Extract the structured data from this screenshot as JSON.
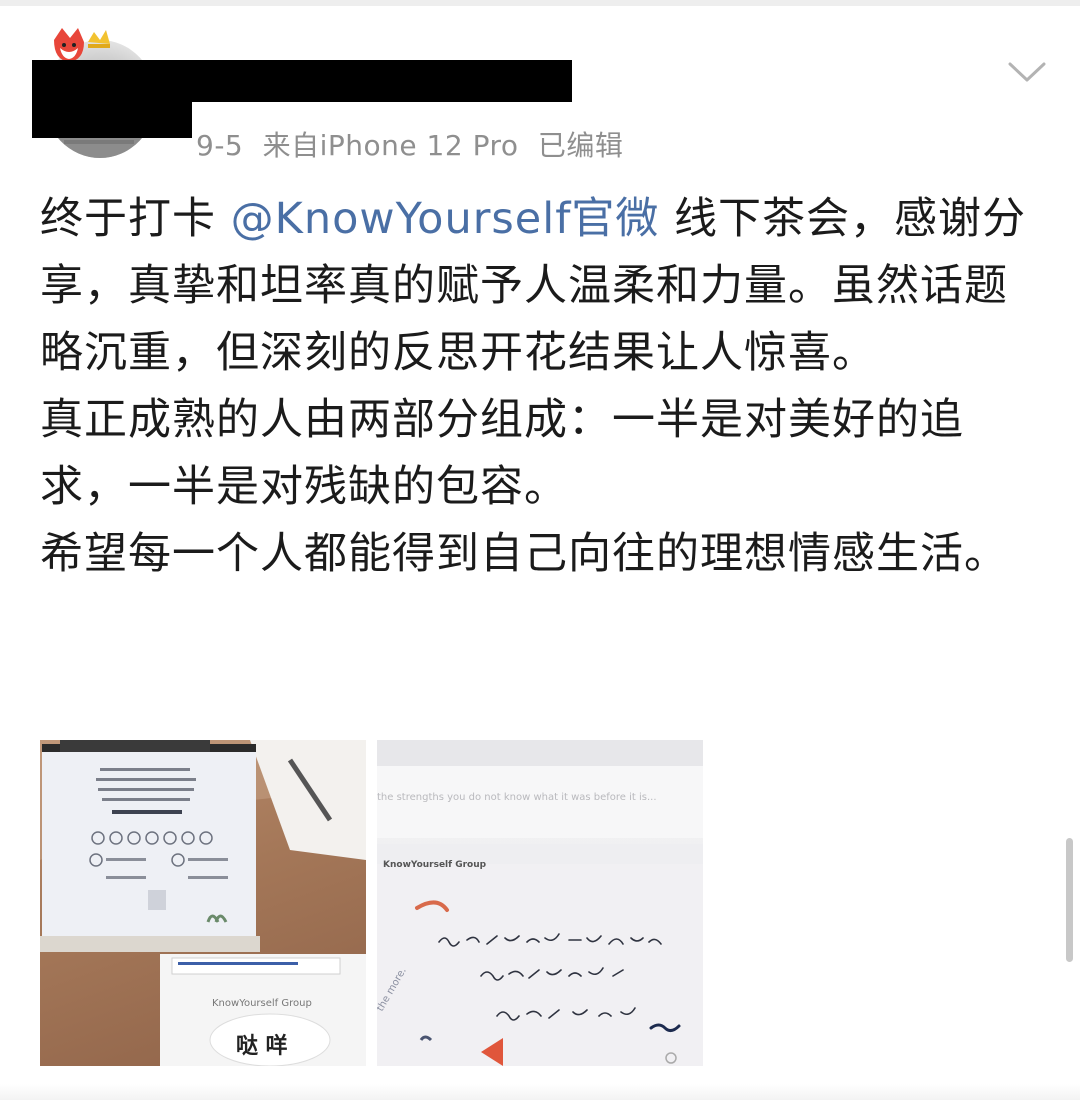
{
  "post": {
    "meta": {
      "date": "9-5",
      "source": "来自iPhone 12 Pro",
      "edited": "已编辑"
    },
    "text": {
      "p1_before": "终于打卡 ",
      "mention": "@KnowYourself官微",
      "p1_after": " 线下茶会，感谢分享，真挚和坦率真的赋予人温柔和力量。虽然话题略沉重，但深刻的反思开花结果让人惊喜。",
      "p2": "真正成熟的人由两部分组成：一半是对美好的追求，一半是对残缺的包容。",
      "p3": "希望每一个人都能得到自己向往的理想情感生活。"
    },
    "images": {
      "photo2_header": "KnowYourself Group",
      "photo2_banner": "the strengths you do not know what it was before it is...",
      "photo2_side": "the more.",
      "photo1_card_label": "KnowYourself Group",
      "photo1_card_sign": "哒 咩"
    }
  },
  "colors": {
    "mention": "#4a6fa5",
    "meta": "#8f8f8f",
    "text": "#1b1b1b"
  },
  "icons": {
    "post_menu": "chevron-down-icon",
    "avatar_badge": "fox-crown-badge-icon"
  }
}
